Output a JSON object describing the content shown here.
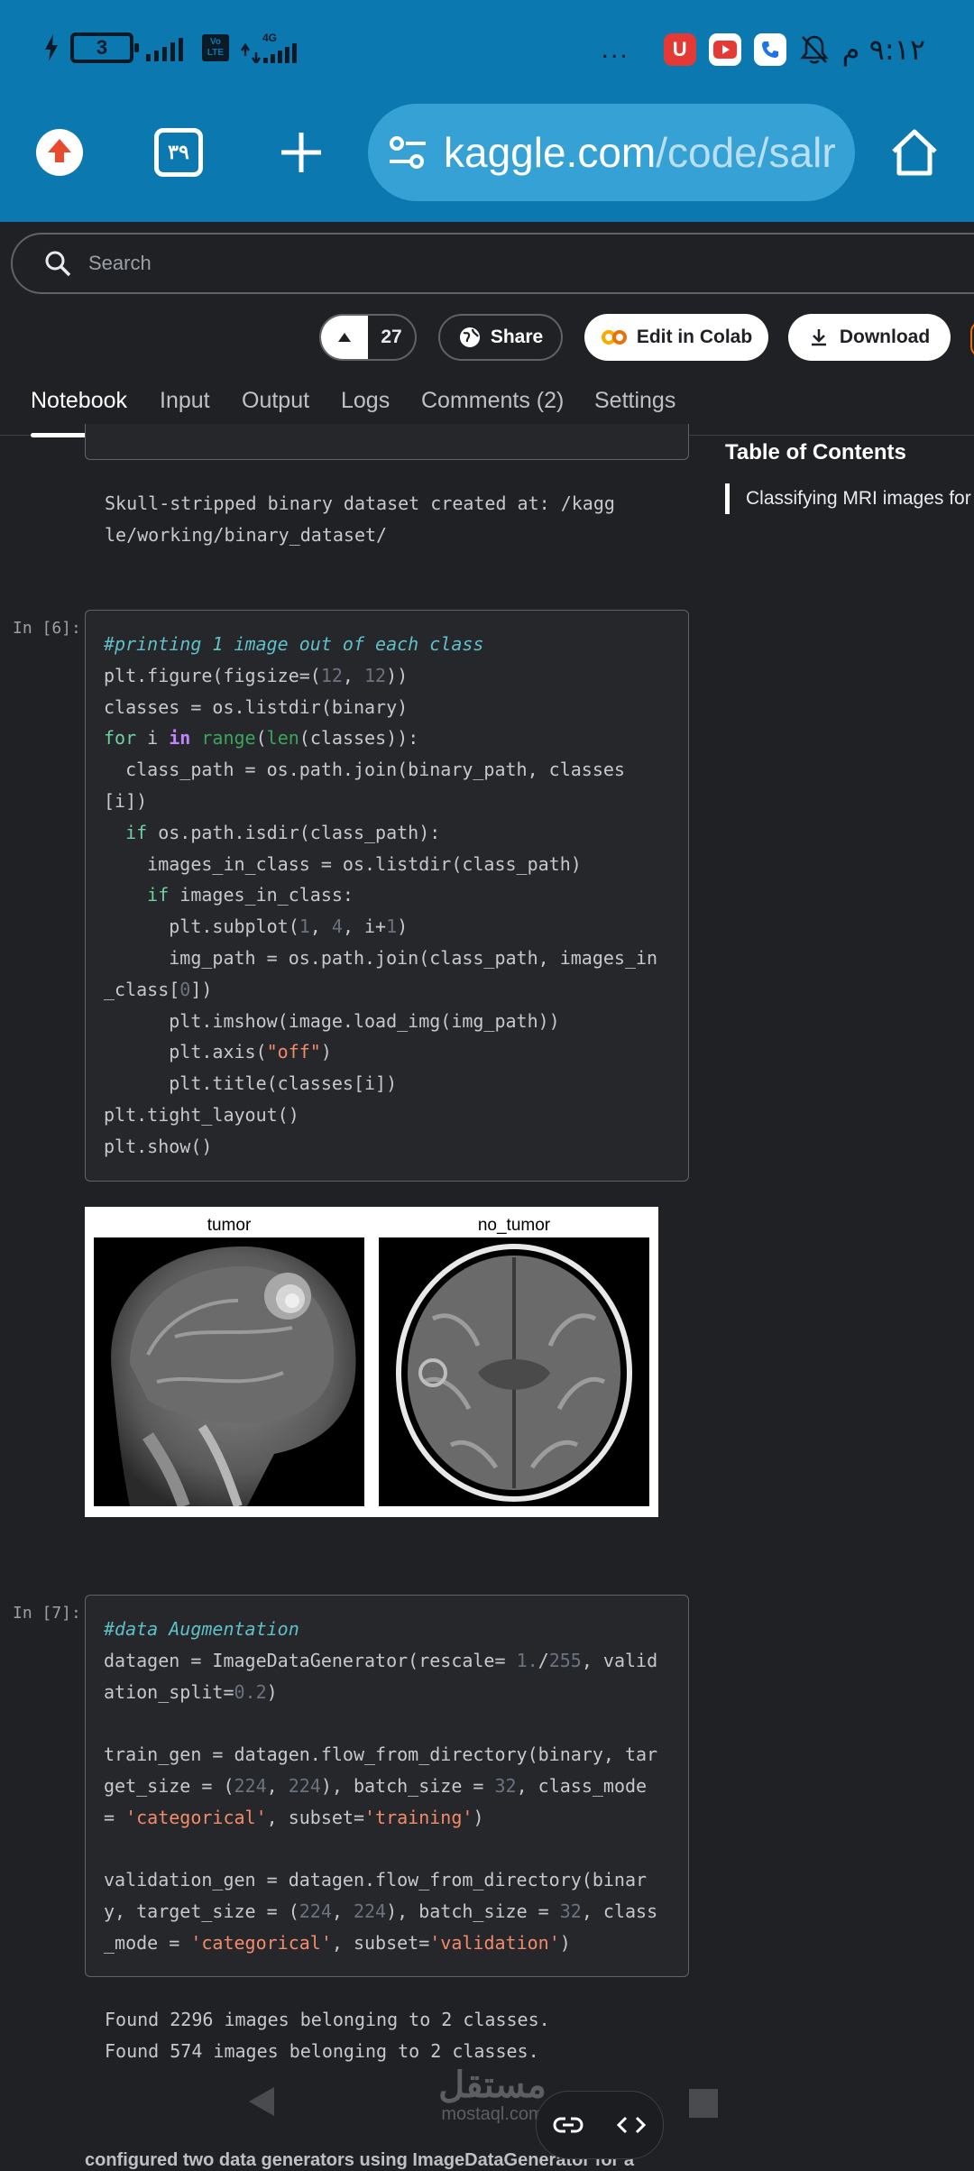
{
  "status_bar": {
    "battery": "3",
    "network": "4G",
    "volte": "Vo LTE",
    "time": "٩:١٢ م",
    "more": "..."
  },
  "browser": {
    "tab_count": "٣٩",
    "url_domain": "kaggle.com",
    "url_path": "/code/salr"
  },
  "kaggle": {
    "search_placeholder": "Search",
    "vote_count": "27",
    "share_label": "Share",
    "colab_label": "Edit in Colab",
    "download_label": "Download",
    "tabs": [
      "Notebook",
      "Input",
      "Output",
      "Logs",
      "Comments (2)",
      "Settings"
    ],
    "active_tab": "Notebook",
    "toc_title": "Table of Contents",
    "toc_items": [
      "Classifying MRI images for"
    ]
  },
  "notebook": {
    "output_top_lines": [
      "Skull-stripped binary dataset created at: /kagg",
      "le/working/binary_dataset/"
    ],
    "cell6_prompt": "In [6]:",
    "figure_titles": [
      "tumor",
      "no_tumor"
    ],
    "cell7_prompt": "In [7]:",
    "cell7_output": [
      "Found 2296 images belonging to 2 classes.",
      "Found 574 images belonging to 2 classes."
    ],
    "markdown_partial": "configured two data generators using ImageDataGenerator for a"
  },
  "overlay": {
    "watermark": "مستقل",
    "watermark_sub": "mostaql.com"
  },
  "colors": {
    "browser_bar": "#0b78b0",
    "page_bg": "#202124",
    "code_bg": "#26272b"
  }
}
